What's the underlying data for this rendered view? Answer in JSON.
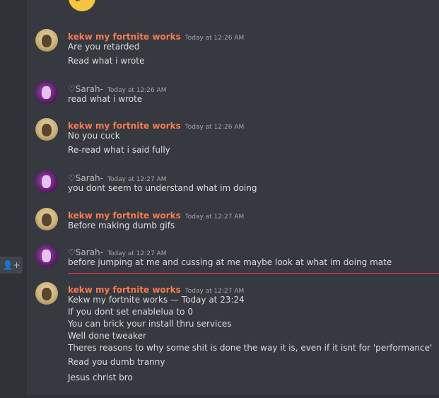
{
  "sidebar": {
    "member_icon": "add-member-icon"
  },
  "colors": {
    "kekw_name": "#f47b50",
    "sarah_name": "#b9bbbe",
    "new_divider": "#ed4245"
  },
  "messages": [
    {
      "author": "kekw my fortnite works",
      "time": "Today at 12:26 AM",
      "lines": [
        "Are you retarded",
        "Read what i wrote"
      ]
    },
    {
      "author": "♡Sarah-",
      "time": "Today at 12:26 AM",
      "lines": [
        "read what i wrote"
      ]
    },
    {
      "author": "kekw my fortnite works",
      "time": "Today at 12:26 AM",
      "lines": [
        "No you cuck",
        "Re-read what i said fully"
      ]
    },
    {
      "author": "♡Sarah-",
      "time": "Today at 12:27 AM",
      "lines": [
        "you dont seem to understand what im doing"
      ]
    },
    {
      "author": "kekw my fortnite works",
      "time": "Today at 12:27 AM",
      "lines": [
        "Before making dumb gifs"
      ]
    },
    {
      "author": "♡Sarah-",
      "time": "Today at 12:27 AM",
      "lines": [
        "before jumping at me and cussing at me maybe look at what im doing mate"
      ]
    },
    {
      "author": "kekw my fortnite works",
      "time": "Today at 12:27 AM",
      "lines": [
        "Kekw my fortnite works — Today at 23:24",
        "If you dont set enablelua to 0",
        "You can brick your install thru services",
        "Well done tweaker",
        "Theres reasons to why some shit is done the way it is, even if it isnt for 'performance'",
        "Read you dumb tranny",
        "Jesus christ bro"
      ]
    }
  ]
}
